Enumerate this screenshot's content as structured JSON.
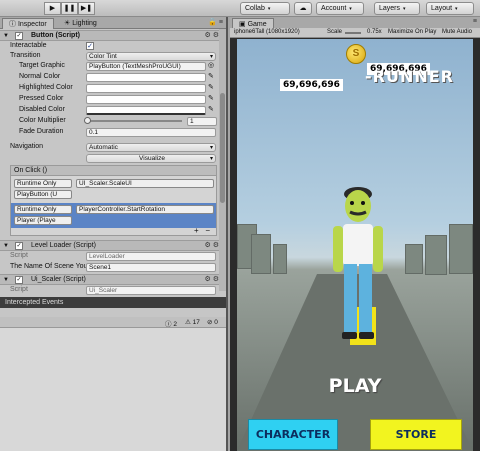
{
  "toolbar": {
    "play": "▶",
    "pause": "❚❚",
    "step": "▶❚",
    "collab": "Collab",
    "cloud": "☁",
    "account": "Account",
    "layers": "Layers",
    "layout": "Layout"
  },
  "inspector": {
    "tabs": [
      "Inspector",
      "Lighting"
    ],
    "button_component": {
      "title": "Button (Script)",
      "interactable_label": "Interactable",
      "transition_label": "Transition",
      "transition_value": "Color Tint",
      "target_graphic_label": "Target Graphic",
      "target_graphic_value": "PlayButton (TextMeshProUGUI)",
      "normal_color_label": "Normal Color",
      "highlighted_color_label": "Highlighted Color",
      "pressed_color_label": "Pressed Color",
      "disabled_color_label": "Disabled Color",
      "color_multiplier_label": "Color Multiplier",
      "color_multiplier_value": "1",
      "fade_duration_label": "Fade Duration",
      "fade_duration_value": "0.1",
      "navigation_label": "Navigation",
      "navigation_value": "Automatic",
      "visualize_label": "Visualize"
    },
    "onclick": {
      "header": "On Click ()",
      "entries": [
        {
          "mode": "Runtime Only",
          "function": "UI_Scaler.ScaleUI",
          "object": "PlayButton (U"
        },
        {
          "mode": "Runtime Only",
          "function": "PlayerController.StartRotation",
          "object": "Player (Playe"
        }
      ],
      "plus": "+",
      "minus": "−"
    },
    "level_loader": {
      "title": "Level Loader (Script)",
      "script_label": "Script",
      "script_value": "LevelLoader",
      "scene_label": "The Name Of Scene You",
      "scene_value": "Scene1"
    },
    "ui_scaler": {
      "title": "Ui_Scaler (Script)",
      "script_label": "Script",
      "script_value": "Ui_Scaler"
    }
  },
  "console": {
    "title": "Intercepted Events",
    "info_count": "2",
    "warning_count": "17",
    "error_count": "0"
  },
  "game": {
    "tab": "Game",
    "resolution": "iphone6Tall (1080x1920)",
    "scale_label": "Scale",
    "scale_value": "0.75x",
    "maximize": "Maximize On Play",
    "mute": "Mute Audio",
    "score1": "69,696,696",
    "score2": "69,696,696",
    "title_fragment": "-RUNNER",
    "play": "PLAY",
    "character_button": "CHARACTER",
    "store_button": "STORE"
  },
  "colors": {
    "character_button": "#2fd0f2",
    "store_button": "#f2f41f",
    "selected_row": "#5b84c6"
  }
}
